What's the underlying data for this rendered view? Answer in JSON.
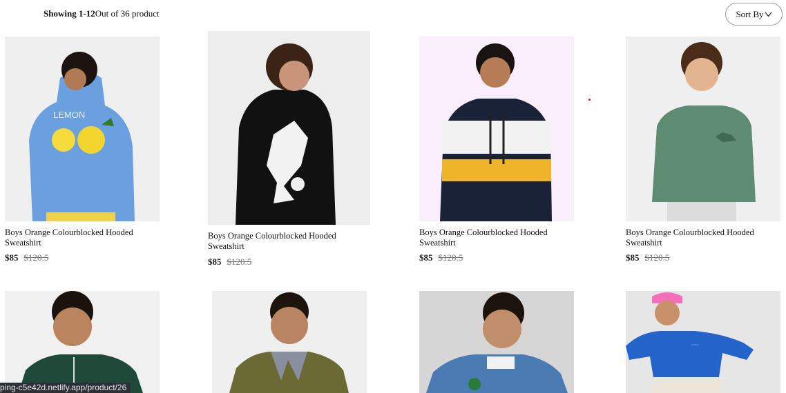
{
  "toolbar": {
    "showing_prefix": "Showing 1-12",
    "showing_suffix": "Out of 36 product",
    "sort_label": "Sort By"
  },
  "products": [
    {
      "title": "Boys Orange Colourblocked Hooded Sweatshirt",
      "price": "$85",
      "old_price": "$120.5",
      "image": "blue-lemon-hoodie"
    },
    {
      "title": "Boys Orange Colourblocked Hooded Sweatshirt",
      "price": "$85",
      "old_price": "$120.5",
      "image": "black-football-hoodie"
    },
    {
      "title": "Boys Orange Colourblocked Hooded Sweatshirt",
      "price": "$85",
      "old_price": "$120.5",
      "image": "navy-white-yellow-hoodie"
    },
    {
      "title": "Boys Orange Colourblocked Hooded Sweatshirt",
      "price": "$85",
      "old_price": "$120.5",
      "image": "green-dino-sweatshirt"
    },
    {
      "image": "green-track-jacket"
    },
    {
      "image": "olive-quilted-jacket"
    },
    {
      "image": "denim-jacket"
    },
    {
      "image": "blue-sweatshirt-pink-beanie"
    }
  ],
  "status_bar": {
    "url": "ping-c5e42d.netlify.app/product/26"
  },
  "colors": {
    "accent_red": "#e11111",
    "status_bg": "#2b2f36"
  }
}
